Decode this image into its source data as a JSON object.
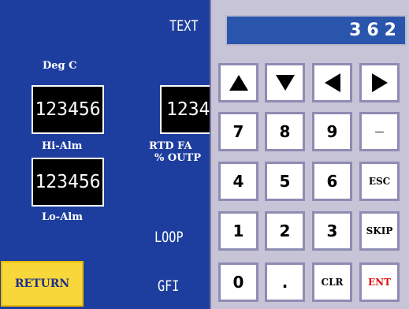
{
  "background_color": "#1d3e9e",
  "hmi": {
    "text_label": "TEXT",
    "deg_label": "Deg C",
    "box1_value": "123456",
    "box2_value": "1234",
    "box3_value": "123456",
    "hi_alm_label": "Hi-Alm",
    "lo_alm_label": "Lo-Alm",
    "rtd_label": "RTD FA",
    "output_label": "% OUTP",
    "loop_label": "LOOP",
    "gfi_label": "GFI",
    "return_label": "RETURN"
  },
  "keypad": {
    "display_value": "362",
    "arrows": [
      "up-arrow-icon",
      "down-arrow-icon",
      "left-arrow-icon",
      "right-arrow-icon"
    ],
    "keys": {
      "k7": "7",
      "k8": "8",
      "k9": "9",
      "dash": "—",
      "k4": "4",
      "k5": "5",
      "k6": "6",
      "esc": "ESC",
      "k1": "1",
      "k2": "2",
      "k3": "3",
      "skip": "SKIP",
      "k0": "0",
      "dot": ".",
      "clr": "CLR",
      "ent": "ENT"
    },
    "colors": {
      "ent": "#e01010",
      "display_bg": "#2a55ad"
    }
  }
}
